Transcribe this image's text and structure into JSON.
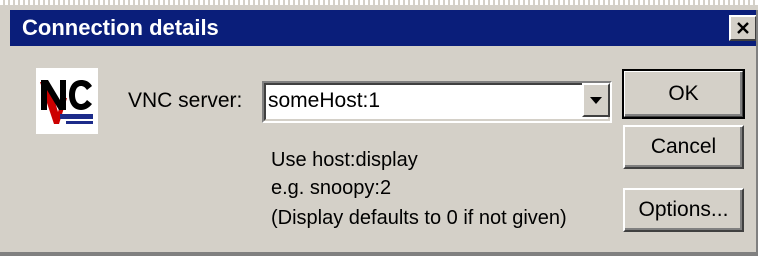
{
  "window": {
    "title": "Connection details",
    "close_icon": "close-icon",
    "titlebar_color": "#0a1e7a",
    "face_color": "#d4d0c8"
  },
  "logo": {
    "icon": "vnc-logo-icon",
    "colors": {
      "letters": "#000000",
      "v_accent": "#cc0000",
      "underline": "#1c2b8a"
    }
  },
  "server": {
    "label": "VNC server:",
    "value": "someHost:1",
    "dropdown_icon": "chevron-down-icon"
  },
  "hint": {
    "line1": "Use host:display",
    "line2": "e.g. snoopy:2",
    "line3": "(Display defaults to 0 if not given)"
  },
  "buttons": {
    "ok": "OK",
    "cancel": "Cancel",
    "options": "Options..."
  }
}
